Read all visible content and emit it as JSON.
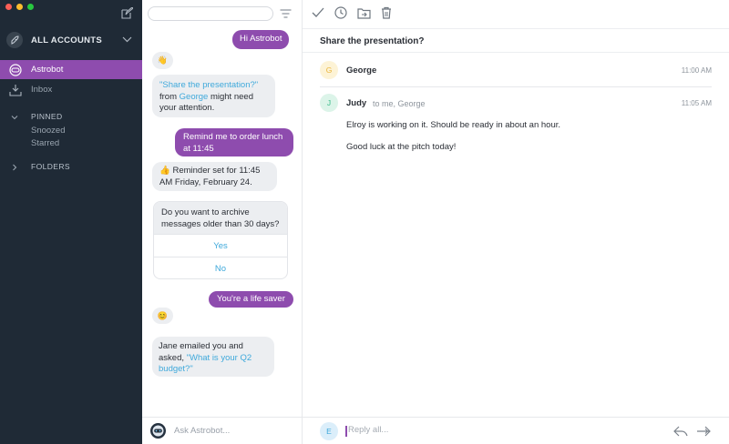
{
  "colors": {
    "sidebar_bg": "#1f2a36",
    "accent_purple": "#8e4cae",
    "link_blue": "#3fa9db",
    "bubble_gray": "#eceef1",
    "traffic_red": "#fc5f57",
    "traffic_yellow": "#fdbc2e",
    "traffic_green": "#28c840"
  },
  "sidebar": {
    "account_label": "ALL ACCOUNTS",
    "items": [
      {
        "label": "Astrobot",
        "icon": "astrobot-icon",
        "active": true
      },
      {
        "label": "Inbox",
        "icon": "inbox-tray-icon",
        "active": false
      }
    ],
    "pinned": {
      "label": "PINNED",
      "items": [
        "Snoozed",
        "Starred"
      ]
    },
    "folders": {
      "label": "FOLDERS"
    }
  },
  "chat": {
    "search": {
      "value": "",
      "placeholder": ""
    },
    "messages": {
      "hi": "Hi Astrobot",
      "wave_emoji": "👋",
      "share_quote": "\"Share the presentation?\"",
      "share_from": "from",
      "share_name": "George",
      "share_tail_1": "might need",
      "share_tail_2": "your attention.",
      "remind_1": "Remind me to order lunch",
      "remind_2": "at 11:45",
      "reminder_emoji": "👍",
      "reminder_1": "Reminder set for 11:45",
      "reminder_2": "AM Friday, February 24.",
      "archive_q_1": "Do you want to archive",
      "archive_q_2": "messages older than 30 days?",
      "yes": "Yes",
      "no": "No",
      "lifesaver": "You're a life saver",
      "smile_emoji": "😊",
      "jane_1": "Jane emailed you and",
      "jane_2": "asked,",
      "jane_q_1": "\"What is your Q2",
      "jane_q_2": "budget?\""
    },
    "ask_placeholder": "Ask Astrobot..."
  },
  "mail": {
    "subject": "Share the presentation?",
    "thread": [
      {
        "initial": "G",
        "sender": "George",
        "recipients": "",
        "time": "11:00 AM"
      },
      {
        "initial": "J",
        "sender": "Judy",
        "recipients": "to me,  George",
        "time": "11:05 AM",
        "body": [
          "Elroy is working on it. Should be ready in about an hour.",
          "Good luck at the pitch today!"
        ]
      }
    ],
    "reply": {
      "initial": "E",
      "placeholder": "Reply all..."
    }
  }
}
